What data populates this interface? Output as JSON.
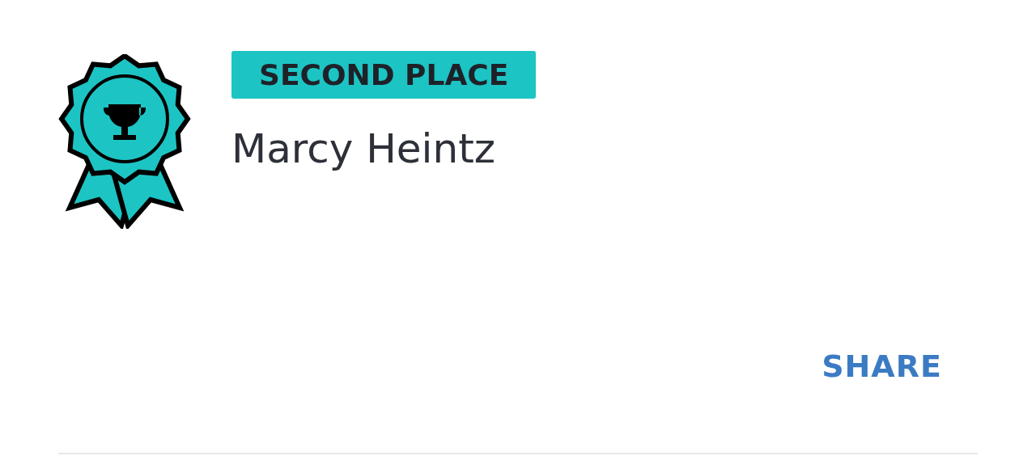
{
  "award": {
    "rank_label": "SECOND PLACE",
    "winner_name": "Marcy Heintz",
    "color": "#1dc4c4"
  },
  "actions": [
    {
      "label": "SHARE"
    }
  ]
}
